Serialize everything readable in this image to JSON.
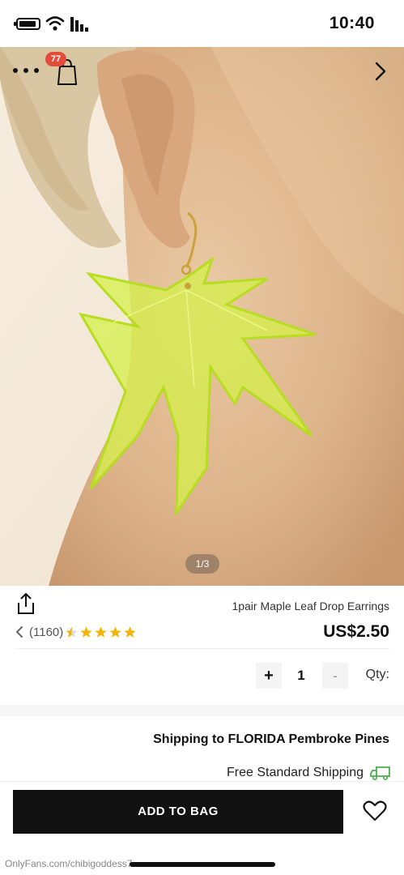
{
  "status_bar": {
    "time": "10:40"
  },
  "gallery": {
    "cart_count": "77",
    "counter": "1/3"
  },
  "product": {
    "title": "1pair Maple Leaf Drop Earrings",
    "price": "US$2.50",
    "rating": 4.5,
    "rating_count": "(1160)"
  },
  "quantity": {
    "label": "Qty:",
    "value": "1",
    "minus_label": "-",
    "plus_label": "+"
  },
  "shipping": {
    "title": "Shipping to FLORIDA Pembroke Pines",
    "method": "Free Standard Shipping"
  },
  "actions": {
    "add_to_bag": "ADD TO BAG"
  },
  "watermark": "OnlyFans.com/chibigoddess7",
  "colors": {
    "primary_button": "#111111",
    "badge": "#e14c3a",
    "star": "#f5b400",
    "truck": "#4caf50",
    "leaf": "#d6f04a"
  },
  "icons": [
    "more-icon",
    "bag-icon",
    "chevron-right-icon",
    "share-icon",
    "star-icon",
    "chevron-left-icon",
    "truck-icon",
    "heart-icon"
  ]
}
